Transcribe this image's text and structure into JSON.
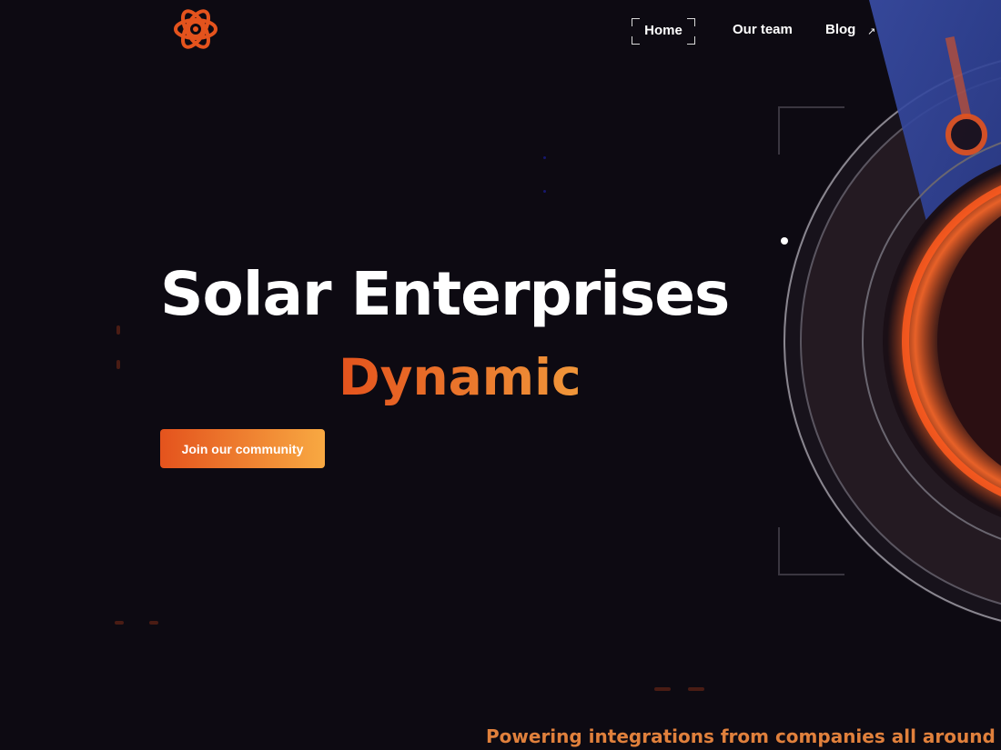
{
  "brand": {
    "logo_icon": "atom-flower-logo-icon",
    "accent": "#e4531d"
  },
  "nav": {
    "items": [
      {
        "label": "Home"
      },
      {
        "label": "Our team"
      },
      {
        "label": "Blog"
      }
    ],
    "blog_icon": "external-arrow-icon"
  },
  "hero": {
    "title": "Solar Enterprises",
    "subtitle": "Dynamic",
    "cta_label": "Join our community"
  },
  "marquee": {
    "text": "Powering integrations from companies all around the world"
  },
  "colors": {
    "background": "#0d0a12",
    "gradient_start": "#e4531d",
    "gradient_end": "#f8a942",
    "marquee": "#e0803c"
  }
}
